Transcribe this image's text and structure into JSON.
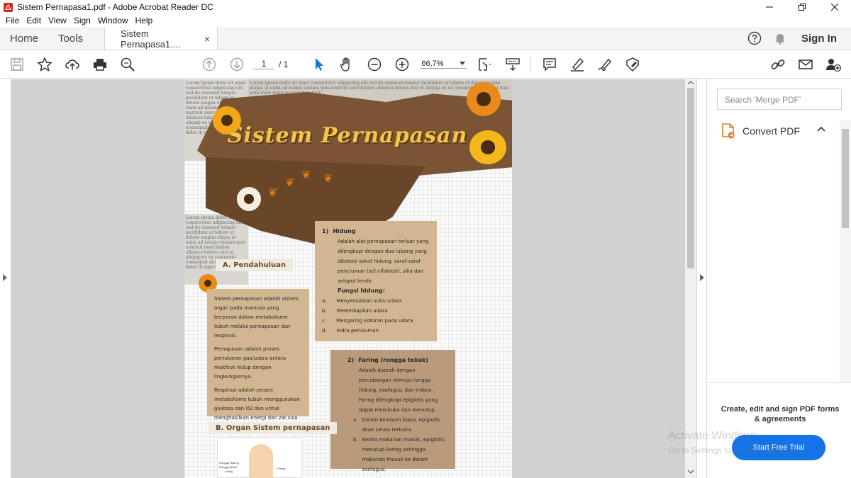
{
  "window": {
    "title": "Sistem Pernapasa1.pdf - Adobe Acrobat Reader DC"
  },
  "menu": [
    "File",
    "Edit",
    "View",
    "Sign",
    "Window",
    "Help"
  ],
  "tabs": {
    "home": "Home",
    "tools": "Tools",
    "document": "Sistem Pernapasa1....",
    "close": "×",
    "sign_in": "Sign In"
  },
  "toolbar": {
    "page_current": "1",
    "page_total": "/ 1",
    "zoom": "66,7%"
  },
  "right_panel": {
    "search_placeholder": "Search 'Merge PDF'",
    "convert_pdf": "Convert PDF",
    "promo_text": "Create, edit and sign PDF forms & agreements",
    "trial_button": "Start Free Trial"
  },
  "watermark": {
    "line1": "Activate Windows",
    "line2": "Go to Settings to activate Windows."
  },
  "pdf": {
    "title": "Sistem Pernapasan",
    "section_a": "A. Pendahuluan",
    "section_b": "B. Organ Sistem pernapasan",
    "intro": [
      "Sistem pernapasan adalah sistem organ pada manusia yang berperan dalam metabolisme tubuh melalui pernapasan dan respirasi.",
      "Pernapasan adalah proses pertukaran gas/udara antara makhluk hidup dengan lingkungannya.",
      "Respirasi adalah proses metabolisme tubuh menggunakan glukosa dan O2 dan untuk menghasilkan energi dan zat sisa CO2."
    ],
    "hidung": {
      "num": "1)",
      "title": "Hidung",
      "desc": "Adalah alat pernapasan terluar yang dilengkapi dengan dua lubang yang dibatasi sekat hidung, saraf-saraf penciuman (sel olfaktori), silia dan selaput lendir.",
      "fungsi_title": "Fungsi hidung:",
      "fungsi": [
        {
          "k": "a.",
          "t": "Menyesuaikan suhu udara"
        },
        {
          "k": "b.",
          "t": "Melembapkan udara"
        },
        {
          "k": "c.",
          "t": "Mengaring kotoran pada udara"
        },
        {
          "k": "d.",
          "t": "Indra penciuman"
        }
      ]
    },
    "faring": {
      "num": "2)",
      "title": "Faring (rongga tekak)",
      "desc": "Adalah daerah dengan percabangan menuju rongga hidung, esofagus, dan trakea. Faring dilengkapi epiglotis yang dapat membuka dan menutup.",
      "items": [
        {
          "k": "a.",
          "t": "Dalam keadaan biasa, epiglotis akan selalu terbuka."
        },
        {
          "k": "b.",
          "t": "Ketika makanan masuk, epiglotis menutup Faring sehingga makanan masuk ke dalam esofagus."
        }
      ]
    },
    "diagram_labels": {
      "l1": "Rongga Hidung",
      "l2": "Rongga Mulut",
      "l3": "Laring",
      "l4": "Faring"
    },
    "news_text": "Lorem ipsum dolor sit amet consectetur adipiscing elit sed do eiusmod tempor incididunt ut labore et dolore magna aliqua ut enim ad minim veniam quis nostrud exercitation ullamco laboris nisi ut aliquip ex ea commodo consequat duis aute irure dolor in reprehenderit"
  }
}
